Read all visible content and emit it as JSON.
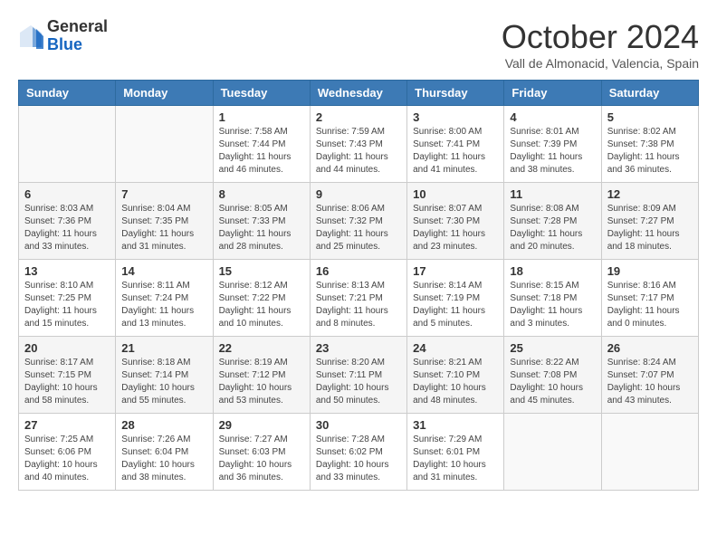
{
  "header": {
    "logo_general": "General",
    "logo_blue": "Blue",
    "month": "October 2024",
    "location": "Vall de Almonacid, Valencia, Spain"
  },
  "columns": [
    "Sunday",
    "Monday",
    "Tuesday",
    "Wednesday",
    "Thursday",
    "Friday",
    "Saturday"
  ],
  "weeks": [
    [
      {
        "day": "",
        "detail": ""
      },
      {
        "day": "",
        "detail": ""
      },
      {
        "day": "1",
        "detail": "Sunrise: 7:58 AM\nSunset: 7:44 PM\nDaylight: 11 hours and 46 minutes."
      },
      {
        "day": "2",
        "detail": "Sunrise: 7:59 AM\nSunset: 7:43 PM\nDaylight: 11 hours and 44 minutes."
      },
      {
        "day": "3",
        "detail": "Sunrise: 8:00 AM\nSunset: 7:41 PM\nDaylight: 11 hours and 41 minutes."
      },
      {
        "day": "4",
        "detail": "Sunrise: 8:01 AM\nSunset: 7:39 PM\nDaylight: 11 hours and 38 minutes."
      },
      {
        "day": "5",
        "detail": "Sunrise: 8:02 AM\nSunset: 7:38 PM\nDaylight: 11 hours and 36 minutes."
      }
    ],
    [
      {
        "day": "6",
        "detail": "Sunrise: 8:03 AM\nSunset: 7:36 PM\nDaylight: 11 hours and 33 minutes."
      },
      {
        "day": "7",
        "detail": "Sunrise: 8:04 AM\nSunset: 7:35 PM\nDaylight: 11 hours and 31 minutes."
      },
      {
        "day": "8",
        "detail": "Sunrise: 8:05 AM\nSunset: 7:33 PM\nDaylight: 11 hours and 28 minutes."
      },
      {
        "day": "9",
        "detail": "Sunrise: 8:06 AM\nSunset: 7:32 PM\nDaylight: 11 hours and 25 minutes."
      },
      {
        "day": "10",
        "detail": "Sunrise: 8:07 AM\nSunset: 7:30 PM\nDaylight: 11 hours and 23 minutes."
      },
      {
        "day": "11",
        "detail": "Sunrise: 8:08 AM\nSunset: 7:28 PM\nDaylight: 11 hours and 20 minutes."
      },
      {
        "day": "12",
        "detail": "Sunrise: 8:09 AM\nSunset: 7:27 PM\nDaylight: 11 hours and 18 minutes."
      }
    ],
    [
      {
        "day": "13",
        "detail": "Sunrise: 8:10 AM\nSunset: 7:25 PM\nDaylight: 11 hours and 15 minutes."
      },
      {
        "day": "14",
        "detail": "Sunrise: 8:11 AM\nSunset: 7:24 PM\nDaylight: 11 hours and 13 minutes."
      },
      {
        "day": "15",
        "detail": "Sunrise: 8:12 AM\nSunset: 7:22 PM\nDaylight: 11 hours and 10 minutes."
      },
      {
        "day": "16",
        "detail": "Sunrise: 8:13 AM\nSunset: 7:21 PM\nDaylight: 11 hours and 8 minutes."
      },
      {
        "day": "17",
        "detail": "Sunrise: 8:14 AM\nSunset: 7:19 PM\nDaylight: 11 hours and 5 minutes."
      },
      {
        "day": "18",
        "detail": "Sunrise: 8:15 AM\nSunset: 7:18 PM\nDaylight: 11 hours and 3 minutes."
      },
      {
        "day": "19",
        "detail": "Sunrise: 8:16 AM\nSunset: 7:17 PM\nDaylight: 11 hours and 0 minutes."
      }
    ],
    [
      {
        "day": "20",
        "detail": "Sunrise: 8:17 AM\nSunset: 7:15 PM\nDaylight: 10 hours and 58 minutes."
      },
      {
        "day": "21",
        "detail": "Sunrise: 8:18 AM\nSunset: 7:14 PM\nDaylight: 10 hours and 55 minutes."
      },
      {
        "day": "22",
        "detail": "Sunrise: 8:19 AM\nSunset: 7:12 PM\nDaylight: 10 hours and 53 minutes."
      },
      {
        "day": "23",
        "detail": "Sunrise: 8:20 AM\nSunset: 7:11 PM\nDaylight: 10 hours and 50 minutes."
      },
      {
        "day": "24",
        "detail": "Sunrise: 8:21 AM\nSunset: 7:10 PM\nDaylight: 10 hours and 48 minutes."
      },
      {
        "day": "25",
        "detail": "Sunrise: 8:22 AM\nSunset: 7:08 PM\nDaylight: 10 hours and 45 minutes."
      },
      {
        "day": "26",
        "detail": "Sunrise: 8:24 AM\nSunset: 7:07 PM\nDaylight: 10 hours and 43 minutes."
      }
    ],
    [
      {
        "day": "27",
        "detail": "Sunrise: 7:25 AM\nSunset: 6:06 PM\nDaylight: 10 hours and 40 minutes."
      },
      {
        "day": "28",
        "detail": "Sunrise: 7:26 AM\nSunset: 6:04 PM\nDaylight: 10 hours and 38 minutes."
      },
      {
        "day": "29",
        "detail": "Sunrise: 7:27 AM\nSunset: 6:03 PM\nDaylight: 10 hours and 36 minutes."
      },
      {
        "day": "30",
        "detail": "Sunrise: 7:28 AM\nSunset: 6:02 PM\nDaylight: 10 hours and 33 minutes."
      },
      {
        "day": "31",
        "detail": "Sunrise: 7:29 AM\nSunset: 6:01 PM\nDaylight: 10 hours and 31 minutes."
      },
      {
        "day": "",
        "detail": ""
      },
      {
        "day": "",
        "detail": ""
      }
    ]
  ]
}
